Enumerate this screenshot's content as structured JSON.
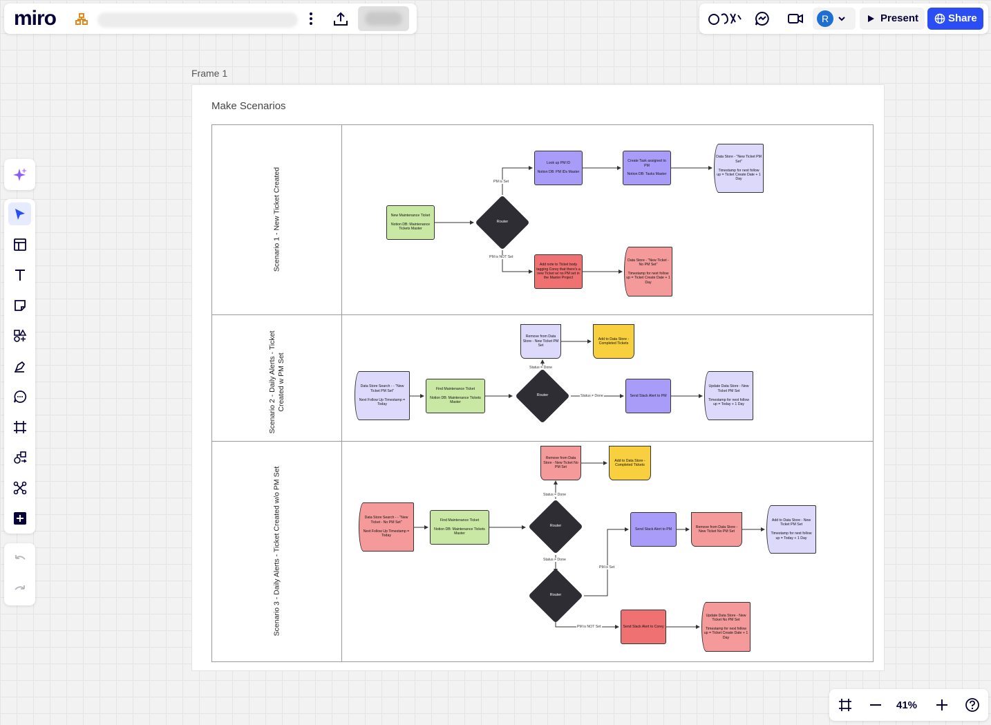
{
  "app": {
    "logo": "miro"
  },
  "toolbar_right": {
    "avatar_initial": "R",
    "present_label": "Present",
    "share_label": "Share"
  },
  "zoom": {
    "level": "41%"
  },
  "frame": {
    "label": "Frame 1",
    "title": "Make Scenarios"
  },
  "lanes": [
    {
      "label": "Scenario 1 - New Ticket Created"
    },
    {
      "label1": "Scenario 2 - Daily Alerts - Ticket",
      "label2": "Created w PM Set"
    },
    {
      "label": "Scenario 3 - Daily Alerts - Ticket Created w/o PM Set"
    }
  ],
  "s1": {
    "new_ticket": "New Maintenance Ticket\n\nNotion DB: Maintenance Tickets Master",
    "router": "Router",
    "pm_set": "PM is Set",
    "pm_not_set": "PM is NOT Set",
    "lookup": "Look up PM ID\n\nNotion DB: PM IDs Master",
    "create_task": "Create Task assigned to PM\n\nNotion DB: Tasks Master",
    "ds_pm_set": "Data Store - \"New Ticket PM Set\"\n\nTimestamp for next follow up = Ticket Create Date + 1 Day",
    "add_note": "Add note to Ticket body tagging Corey that there's a new Ticket w/ no PM set in the Master Project",
    "ds_no_pm": "Data Store - \"New Ticket - No PM Set\"\n\nTimestamp for next follow up = Ticket Create Date + 1 Day"
  },
  "s2": {
    "search": "Data Store Search - - \"New Ticket PM Set\"\n\nNext Follow Up Timestamp = Today",
    "find": "Find Maintenance Ticket\n\nNotion DB: Maintenance Tickets Master",
    "router": "Router",
    "done": "Status = Done",
    "not_done": "Status ≠ Done",
    "remove": "Remove from Data Store - New Ticket PM Set",
    "add_completed": "Add to Data Store - Completed Tickets",
    "slack": "Send Slack Alert to PM",
    "update": "Update Data Store - New Ticket PM Set\n\nTimestamp for next follow up = Today + 1 Day"
  },
  "s3": {
    "search": "Data Store Search - - \"New Ticket - No PM Set\"\n\nNext Follow Up Timestamp = Today",
    "find": "Find Maintenance Ticket\n\nNotion DB: Maintenance Tickets Master",
    "router1": "Router",
    "router2": "Router",
    "done": "Status = Done",
    "not_done": "Status ≠ Done",
    "pm_set": "PM is Set",
    "pm_not_set": "PM is NOT Set",
    "remove": "Remove from Data Store - New Ticket No PM Set",
    "add_completed": "Add to Data Store - Completed Tickets",
    "slack_pm": "Send Slack Alert to PM",
    "remove2": "Remove from Data Store - New Ticket No PM Set",
    "add_pm_set": "Add to Data Store - New Ticket PM Set\n\nTimestamp for next follow up = Today + 1 Day",
    "slack_corey": "Send Slack Alert to Corey",
    "update": "Update Data Store - New Ticket No PM Set\n\nTimestamp for next follow up = Ticket Create Date + 1 Day"
  }
}
